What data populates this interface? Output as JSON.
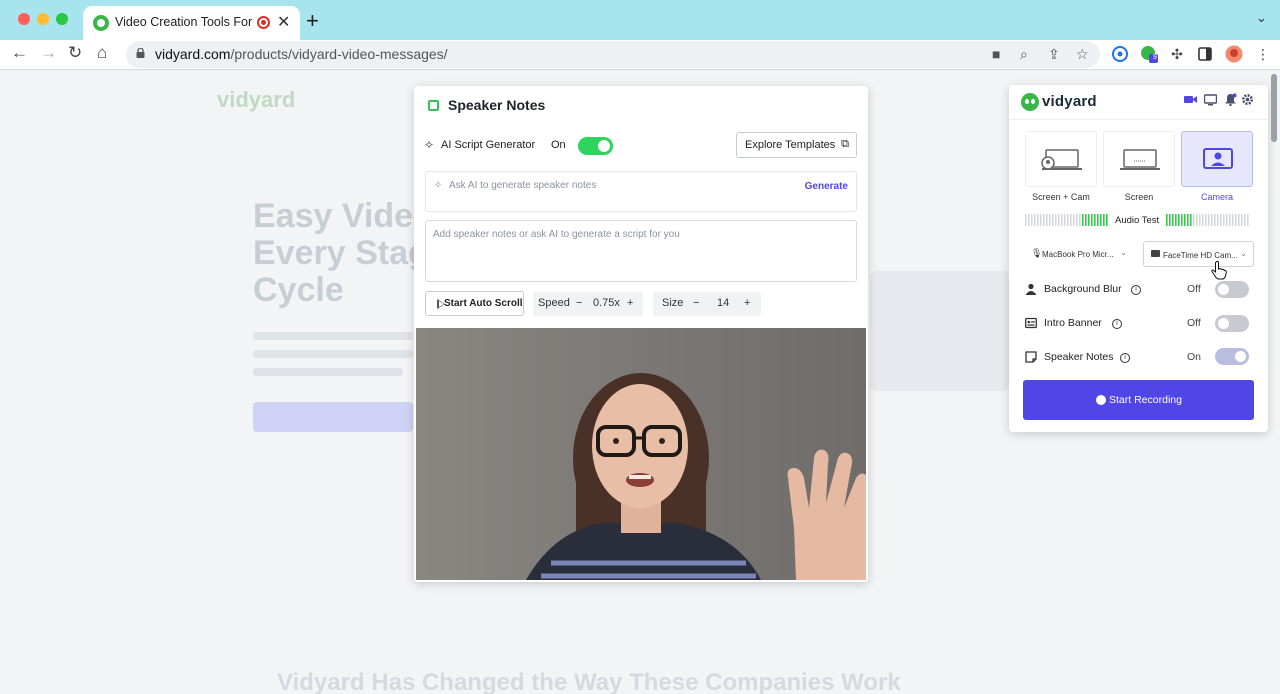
{
  "browser": {
    "tab_title": "Video Creation Tools For Yo",
    "tab_close": "✕",
    "new_tab": "+",
    "url_host": "vidyard.com",
    "url_path": "/products/vidyard-video-messages/",
    "extension_badge": "9"
  },
  "page": {
    "logo": "vidyard",
    "hero_heading": "Easy Video Every Stage Cycle",
    "bottom_heading": "Vidyard Has Changed the Way These Companies Work"
  },
  "speaker_notes": {
    "title": "Speaker Notes",
    "ai_label": "AI Script Generator",
    "ai_state": "On",
    "explore_label": "Explore Templates",
    "ask_placeholder": "Ask AI to generate speaker notes",
    "generate_label": "Generate",
    "notes_placeholder": "Add speaker notes or ask AI to generate a script for you",
    "autoscroll_label": "Start Auto Scroll",
    "speed_label": "Speed",
    "speed_value": "0.75x",
    "size_label": "Size",
    "size_value": "14",
    "minus": "−",
    "plus": "+"
  },
  "recorder": {
    "logo": "vidyard",
    "modes": [
      {
        "label": "Screen + Cam",
        "selected": false
      },
      {
        "label": "Screen",
        "selected": false
      },
      {
        "label": "Camera",
        "selected": true
      }
    ],
    "audio_test_label": "Audio Test",
    "mic_device": "MacBook Pro Micr...",
    "camera_device": "FaceTime HD Cam...",
    "options": [
      {
        "label": "Background Blur",
        "state": "Off"
      },
      {
        "label": "Intro Banner",
        "state": "Off"
      },
      {
        "label": "Speaker Notes",
        "state": "On"
      }
    ],
    "start_label": "Start Recording"
  },
  "colors": {
    "accent": "#4f46e5",
    "toggle_on": "#2fd45f",
    "brand_green": "#39b54a",
    "tab_bar": "#a7e4ed"
  }
}
